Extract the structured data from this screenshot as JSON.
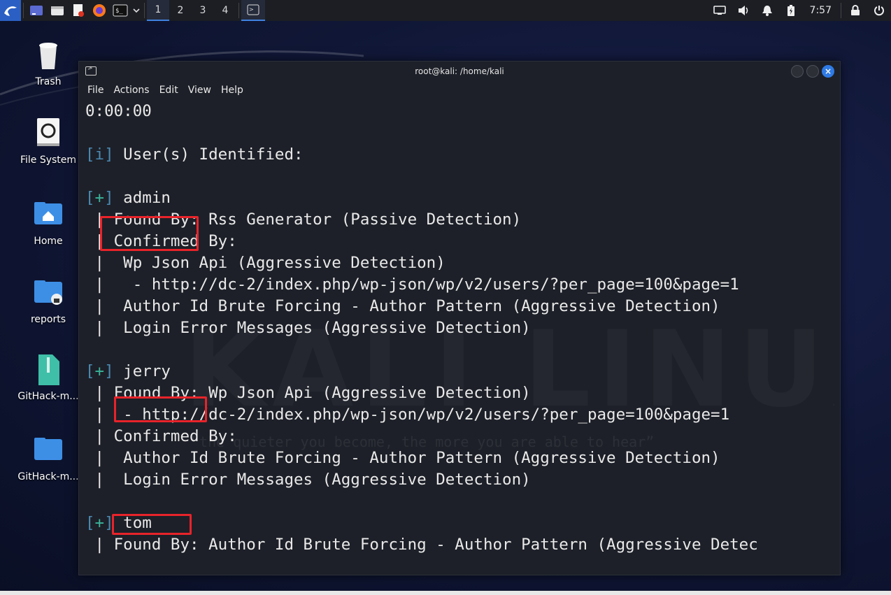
{
  "panel": {
    "workspaces": [
      "1",
      "2",
      "3",
      "4"
    ],
    "clock": "7:57"
  },
  "desktop": {
    "icons": [
      {
        "label": "Trash"
      },
      {
        "label": "File System"
      },
      {
        "label": "Home"
      },
      {
        "label": "reports"
      },
      {
        "label": "GitHack-m..."
      },
      {
        "label": "GitHack-m..."
      }
    ]
  },
  "window": {
    "title": "root@kali: /home/kali",
    "menu": [
      "File",
      "Actions",
      "Edit",
      "View",
      "Help"
    ]
  },
  "terminal": {
    "watermark": "KALI LINUX",
    "quote": "“the quieter you become, the more you are able to hear”",
    "lines": [
      "0:00:00",
      "",
      "[i] User(s) Identified:",
      "",
      "[+] admin",
      " | Found By: Rss Generator (Passive Detection)",
      " | Confirmed By:",
      " |  Wp Json Api (Aggressive Detection)",
      " |   - http://dc-2/index.php/wp-json/wp/v2/users/?per_page=100&page=1",
      " |  Author Id Brute Forcing - Author Pattern (Aggressive Detection)",
      " |  Login Error Messages (Aggressive Detection)",
      "",
      "[+] jerry",
      " | Found By: Wp Json Api (Aggressive Detection)",
      " |  - http://dc-2/index.php/wp-json/wp/v2/users/?per_page=100&page=1",
      " | Confirmed By:",
      " |  Author Id Brute Forcing - Author Pattern (Aggressive Detection)",
      " |  Login Error Messages (Aggressive Detection)",
      "",
      "[+] tom",
      " | Found By: Author Id Brute Forcing - Author Pattern (Aggressive Detec"
    ]
  },
  "colors": {
    "highlight": "#e8232a",
    "accent": "#2f7ae5",
    "bracket": "#4b8ab3",
    "plus": "#3ab39a"
  }
}
